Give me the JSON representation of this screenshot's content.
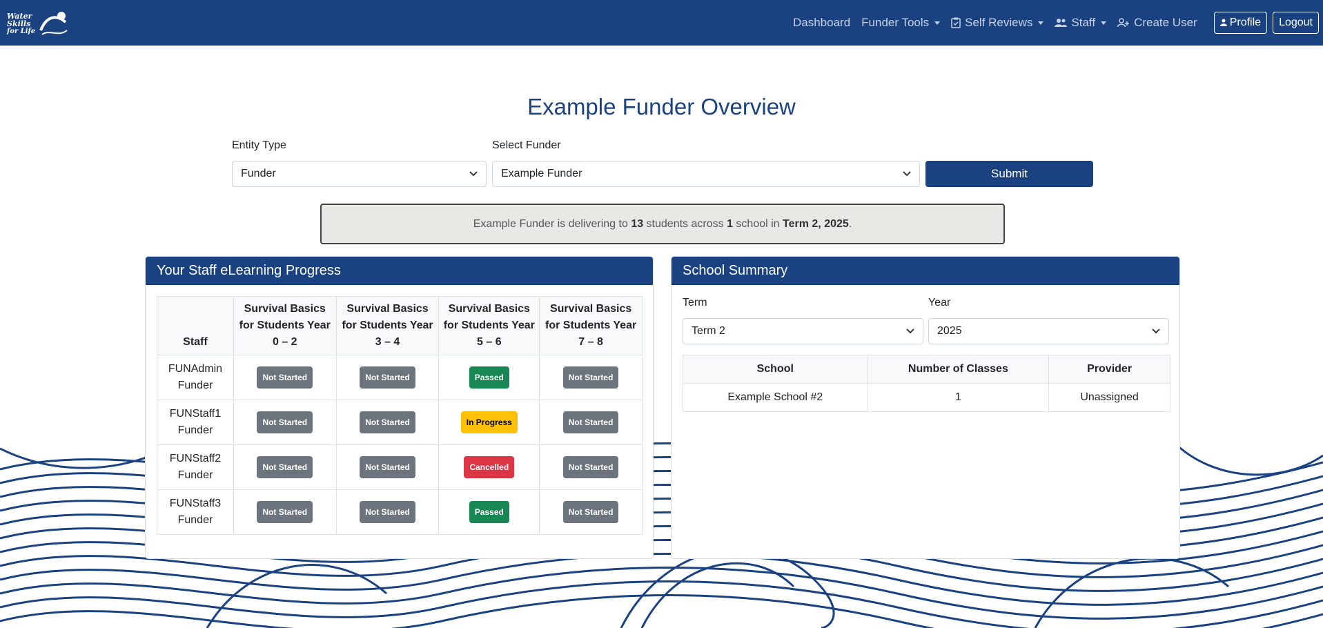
{
  "brand": {
    "line1": "Water",
    "line2": "Skills",
    "line3": "for Life"
  },
  "nav": {
    "dashboard": "Dashboard",
    "funder_tools": "Funder Tools",
    "self_reviews": "Self Reviews",
    "staff": "Staff",
    "create_user": "Create User",
    "profile": "Profile",
    "logout": "Logout"
  },
  "page_title": "Example Funder Overview",
  "filters": {
    "entity_type_label": "Entity Type",
    "entity_type_value": "Funder",
    "select_funder_label": "Select Funder",
    "select_funder_value": "Example Funder",
    "submit": "Submit"
  },
  "alert": {
    "funder": "Example Funder",
    "t1": " is delivering to ",
    "students": "13",
    "t2": " students across ",
    "schools": "1",
    "t3": " school in ",
    "term": "Term 2, 2025",
    "t4": "."
  },
  "staff_card": {
    "title": "Your Staff eLearning Progress",
    "headers": [
      "Staff",
      "Survival Basics for Students Year 0 – 2",
      "Survival Basics for Students Year 3 – 4",
      "Survival Basics for Students Year 5 – 6",
      "Survival Basics for Students Year 7 – 8"
    ],
    "rows": [
      {
        "name": "FUNAdmin",
        "role": "Funder",
        "status": [
          "Not Started",
          "Not Started",
          "Passed",
          "Not Started"
        ]
      },
      {
        "name": "FUNStaff1",
        "role": "Funder",
        "status": [
          "Not Started",
          "Not Started",
          "In Progress",
          "Not Started"
        ]
      },
      {
        "name": "FUNStaff2",
        "role": "Funder",
        "status": [
          "Not Started",
          "Not Started",
          "Cancelled",
          "Not Started"
        ]
      },
      {
        "name": "FUNStaff3",
        "role": "Funder",
        "status": [
          "Not Started",
          "Not Started",
          "Passed",
          "Not Started"
        ]
      }
    ]
  },
  "school_card": {
    "title": "School Summary",
    "term_label": "Term",
    "term_value": "Term 2",
    "year_label": "Year",
    "year_value": "2025",
    "headers": [
      "School",
      "Number of Classes",
      "Provider"
    ],
    "rows": [
      {
        "school": "Example School #2",
        "classes": "1",
        "provider": "Unassigned"
      }
    ]
  },
  "colors": {
    "navy": "#1a4280",
    "not_started": "#6c757d",
    "passed": "#198754",
    "in_progress": "#ffc107",
    "cancelled": "#dc3545"
  }
}
